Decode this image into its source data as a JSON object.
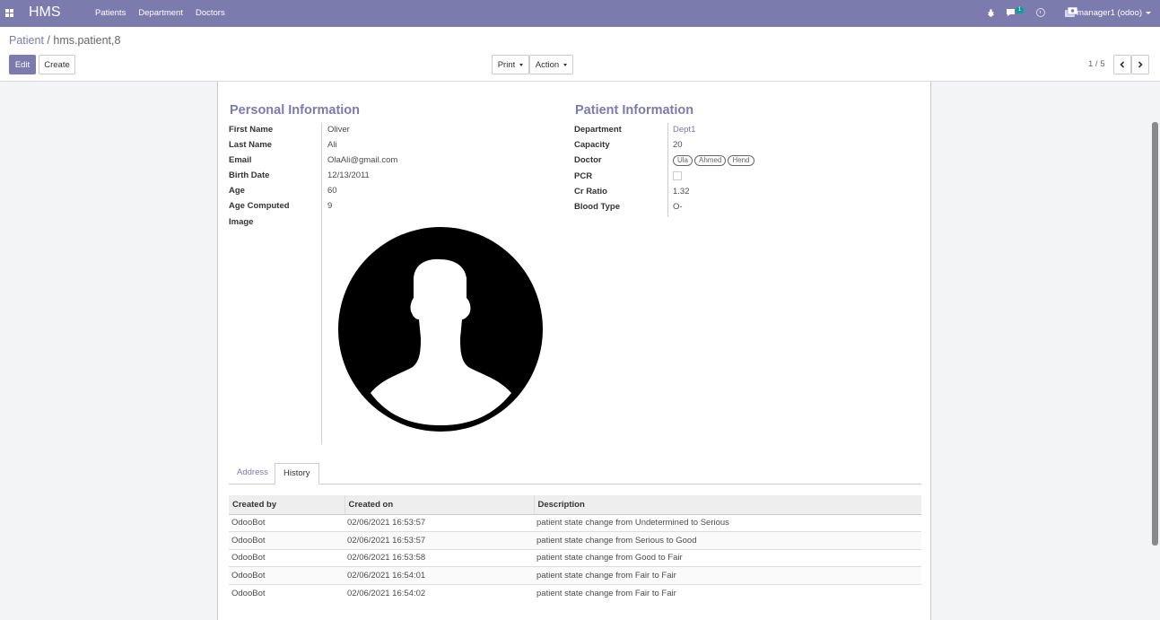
{
  "navbar": {
    "app_name": "HMS",
    "menu": [
      "Patients",
      "Department",
      "Doctors"
    ],
    "chat_count": "1",
    "user": "manager1 (odoo)",
    "accent": "#7c7bad"
  },
  "breadcrumb": {
    "parent": "Patient",
    "separator": "/",
    "current": "hms.patient,8"
  },
  "buttons": {
    "edit": "Edit",
    "create": "Create",
    "print": "Print",
    "action": "Action"
  },
  "pager": {
    "value": "1 / 5"
  },
  "personal": {
    "title": "Personal Information",
    "fields": [
      {
        "label": "First Name",
        "value": "Oliver"
      },
      {
        "label": "Last Name",
        "value": "Ali"
      },
      {
        "label": "Email",
        "value": "OlaAli@gmail.com"
      },
      {
        "label": "Birth Date",
        "value": "12/13/2011"
      },
      {
        "label": "Age",
        "value": "60"
      },
      {
        "label": "Age Computed",
        "value": "9"
      },
      {
        "label": "Image",
        "value": ""
      }
    ]
  },
  "patient": {
    "title": "Patient Information",
    "department_label": "Department",
    "department_value": "Dept1",
    "capacity_label": "Capacity",
    "capacity_value": "20",
    "doctor_label": "Doctor",
    "doctors": [
      "Ula",
      "Ahmed",
      "Hend"
    ],
    "pcr_label": "PCR",
    "pcr_checked": false,
    "cr_ratio_label": "Cr Ratio",
    "cr_ratio_value": "1.32",
    "blood_type_label": "Blood Type",
    "blood_type_value": "O-"
  },
  "tabs": [
    {
      "label": "Address",
      "active": false
    },
    {
      "label": "History",
      "active": true
    }
  ],
  "history": {
    "columns": [
      "Created by",
      "Created on",
      "Description"
    ],
    "rows": [
      [
        "OdooBot",
        "02/06/2021 16:53:57",
        "patient state change from Undetermined to Serious"
      ],
      [
        "OdooBot",
        "02/06/2021 16:53:57",
        "patient state change from Serious to Good"
      ],
      [
        "OdooBot",
        "02/06/2021 16:53:58",
        "patient state change from Good to Fair"
      ],
      [
        "OdooBot",
        "02/06/2021 16:54:01",
        "patient state change from Fair to Fair"
      ],
      [
        "OdooBot",
        "02/06/2021 16:54:02",
        "patient state change from Fair to Fair"
      ]
    ]
  }
}
